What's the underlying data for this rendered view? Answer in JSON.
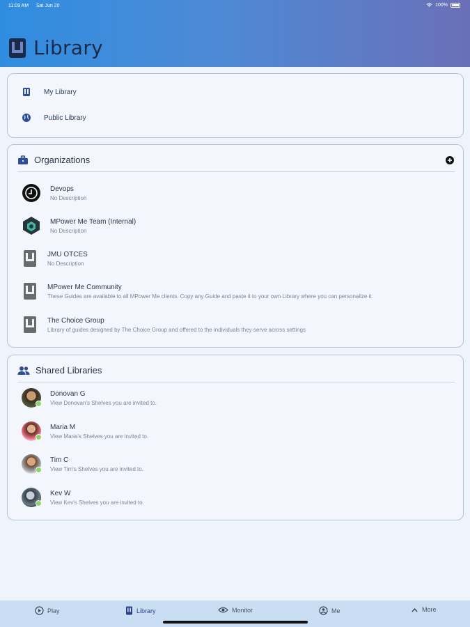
{
  "status_bar": {
    "time": "11:09 AM",
    "date": "Sat Jun 20",
    "battery": "100%"
  },
  "header": {
    "title": "Library"
  },
  "nav_card": {
    "items": [
      {
        "label": "My Library",
        "icon": "book-icon"
      },
      {
        "label": "Public Library",
        "icon": "globe-icon"
      }
    ]
  },
  "organizations": {
    "title": "Organizations",
    "items": [
      {
        "name": "Devops",
        "desc": "No Description"
      },
      {
        "name": "MPower Me Team (Internal)",
        "desc": "No Description"
      },
      {
        "name": "JMU OTCES",
        "desc": "No Description"
      },
      {
        "name": "MPower Me Community",
        "desc": "These Guides are available to all MPower Me clients. Copy any Guide and paste it to your own Library where you can personalize it."
      },
      {
        "name": "The Choice Group",
        "desc": "Library of guides designed by The Choice Group and offered to the individuals they serve across settings"
      }
    ]
  },
  "shared": {
    "title": "Shared Libraries",
    "items": [
      {
        "name": "Donovan G",
        "desc": "View Donovan's Shelves you are invited to."
      },
      {
        "name": "Maria M",
        "desc": "View Maria's Shelves you are invited to."
      },
      {
        "name": "Tim C",
        "desc": "View Tim's Shelves you are invited to."
      },
      {
        "name": "Kev W",
        "desc": "View Kev's Shelves you are invited to."
      }
    ]
  },
  "tabs": [
    {
      "label": "Play",
      "icon": "play-circle-icon"
    },
    {
      "label": "Library",
      "icon": "book-icon"
    },
    {
      "label": "Monitor",
      "icon": "eye-icon"
    },
    {
      "label": "Me",
      "icon": "user-circle-icon"
    },
    {
      "label": "More",
      "icon": "chevron-up-icon"
    }
  ],
  "colors": {
    "accent": "#2c3f88",
    "header_start": "#2f8de0",
    "header_end": "#6a70b8"
  }
}
